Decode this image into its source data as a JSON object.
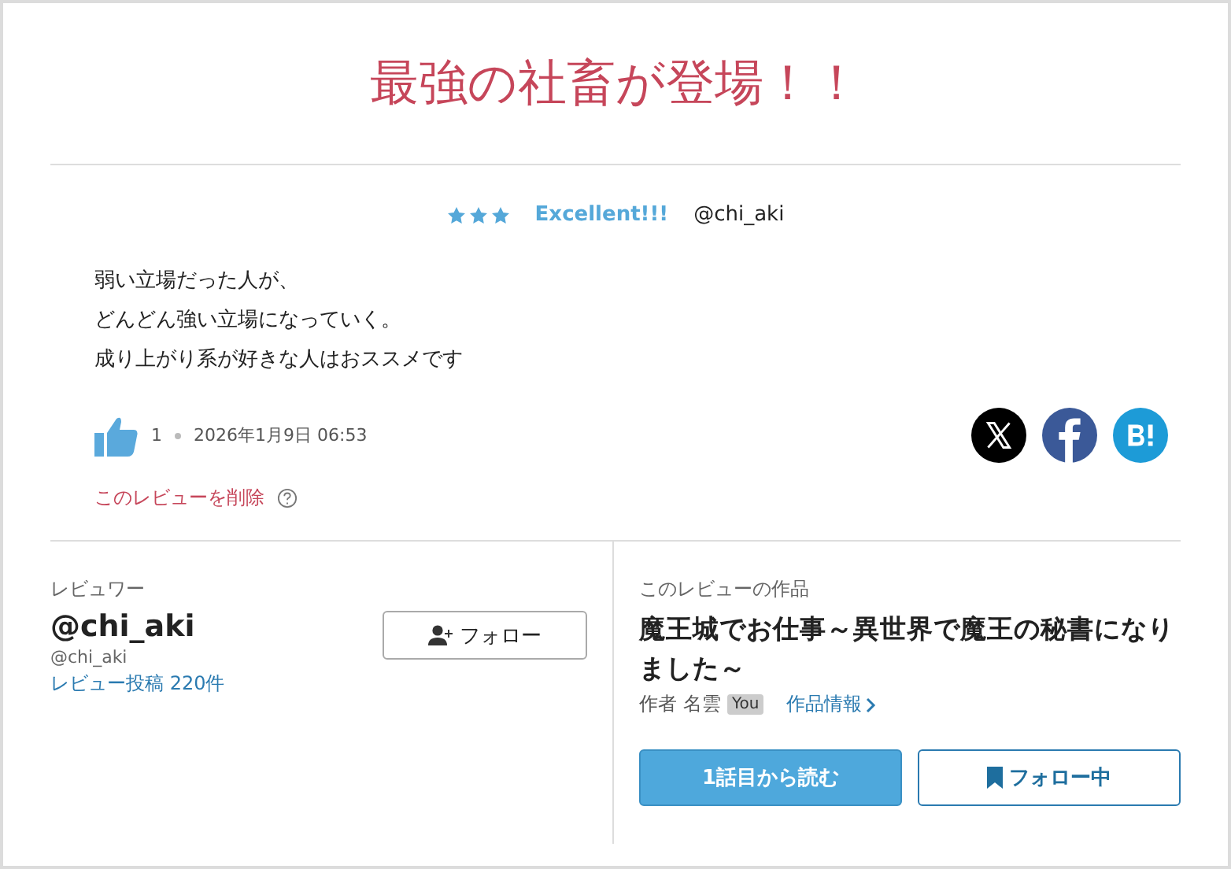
{
  "title": "最強の社畜が登場！！",
  "review": {
    "stars": 3,
    "rating": "Excellent!!!",
    "reviewer": "@chi_aki",
    "lines": [
      "弱い立場だった人が、",
      "どんどん強い立場になっていく。",
      "成り上がり系が好きな人はおススメです"
    ],
    "likes": "1",
    "date": "2026年1月9日 06:53",
    "delete_link": "このレビューを削除"
  },
  "reviewer": {
    "heading": "レビュワー",
    "name": "@chi_aki",
    "handle": "@chi_aki",
    "review_count": "レビュー投稿 220件",
    "follow_button": "フォロー"
  },
  "work": {
    "heading": "このレビューの作品",
    "title": "魔王城でお仕事～異世界で魔王の秘書になりました～",
    "author_label": "作者",
    "author": "名雲",
    "author_badge": "You",
    "info_link": "作品情報",
    "read_button": "1話目から読む",
    "follow_button": "フォロー中"
  }
}
